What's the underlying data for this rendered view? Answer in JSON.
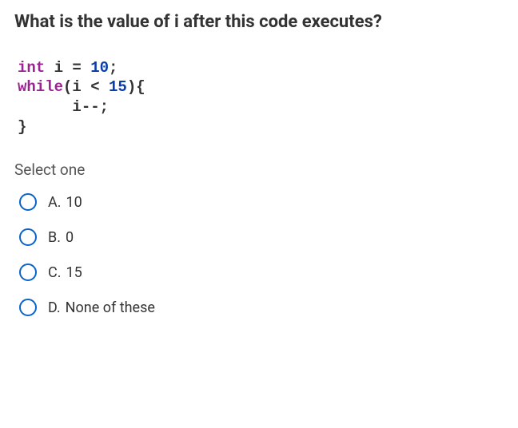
{
  "question": {
    "title": "What is the value of i after this code executes?",
    "prompt": "Select one"
  },
  "code": {
    "line1_kw": "int",
    "line1_rest": " i = ",
    "line1_num": "10",
    "line1_end": ";",
    "line2_kw": "while",
    "line2_rest": "(i < ",
    "line2_num": "15",
    "line2_end": "){",
    "line3": "      i--;",
    "line4": "}"
  },
  "options": [
    {
      "letter": "A.",
      "text": "10"
    },
    {
      "letter": "B.",
      "text": "0"
    },
    {
      "letter": "C.",
      "text": "15"
    },
    {
      "letter": "D.",
      "text": "None of these"
    }
  ]
}
